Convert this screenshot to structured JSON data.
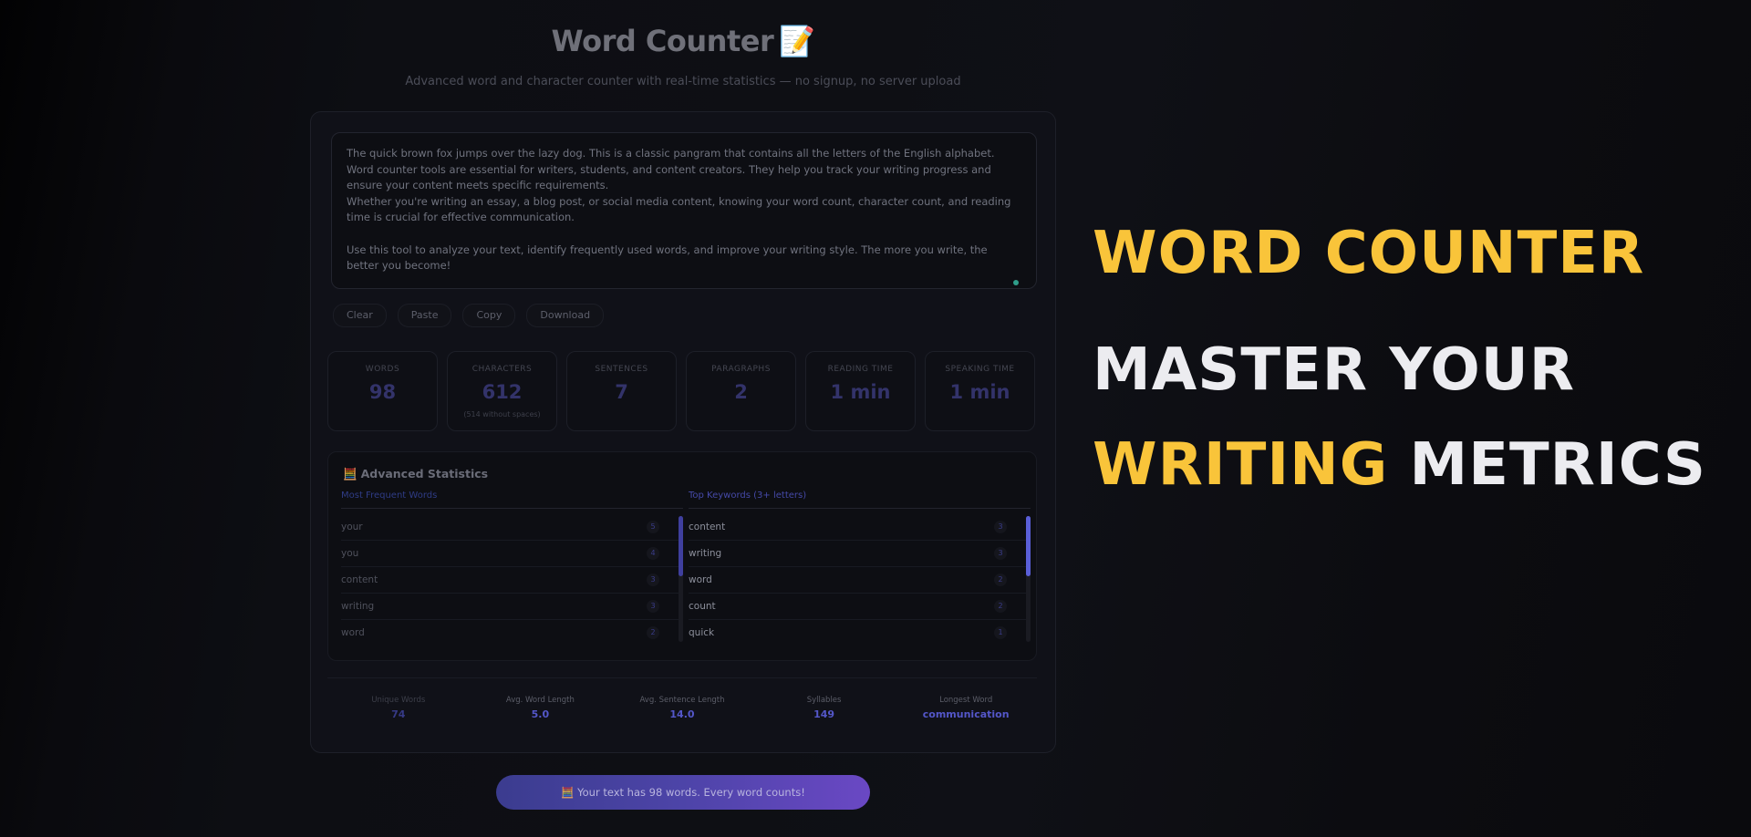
{
  "app": {
    "title": "Word Counter",
    "title_emoji": "📝",
    "subtitle": "Advanced word and character counter with real-time statistics — no signup, no server upload"
  },
  "editor": {
    "text": "The quick brown fox jumps over the lazy dog. This is a classic pangram that contains all the letters of the English alphabet.\nWord counter tools are essential for writers, students, and content creators. They help you track your writing progress and ensure your content meets specific requirements.\nWhether you're writing an essay, a blog post, or social media content, knowing your word count, character count, and reading time is crucial for effective communication.\n\nUse this tool to analyze your text, identify frequently used words, and improve your writing style. The more you write, the better you become!"
  },
  "actions": {
    "clear": "Clear",
    "paste": "Paste",
    "copy": "Copy",
    "download": "Download"
  },
  "stats": [
    {
      "label": "WORDS",
      "value": "98",
      "sub": ""
    },
    {
      "label": "CHARACTERS",
      "value": "612",
      "sub": "(514 without spaces)"
    },
    {
      "label": "SENTENCES",
      "value": "7",
      "sub": ""
    },
    {
      "label": "PARAGRAPHS",
      "value": "2",
      "sub": ""
    },
    {
      "label": "READING TIME",
      "value": "1 min",
      "sub": ""
    },
    {
      "label": "SPEAKING TIME",
      "value": "1 min",
      "sub": ""
    }
  ],
  "advanced": {
    "icon": "abacus-icon",
    "title": "Advanced Statistics",
    "frequent": {
      "heading": "Most Frequent Words",
      "items": [
        {
          "word": "your",
          "count": "5"
        },
        {
          "word": "you",
          "count": "4"
        },
        {
          "word": "content",
          "count": "3"
        },
        {
          "word": "writing",
          "count": "3"
        },
        {
          "word": "word",
          "count": "2"
        }
      ]
    },
    "keywords": {
      "heading": "Top Keywords (3+ letters)",
      "items": [
        {
          "word": "content",
          "count": "3"
        },
        {
          "word": "writing",
          "count": "3"
        },
        {
          "word": "word",
          "count": "2"
        },
        {
          "word": "count",
          "count": "2"
        },
        {
          "word": "quick",
          "count": "1"
        }
      ]
    }
  },
  "metrics": [
    {
      "label": "Unique Words",
      "value": "74"
    },
    {
      "label": "Avg. Word Length",
      "value": "5.0"
    },
    {
      "label": "Avg. Sentence Length",
      "value": "14.0"
    },
    {
      "label": "Syllables",
      "value": "149"
    },
    {
      "label": "Longest Word",
      "value": "communication"
    }
  ],
  "banner": {
    "icon": "abacus-icon",
    "text": "Your text has 98 words. Every word counts!"
  },
  "hero": {
    "line1": "WORD COUNTER",
    "line2": "MASTER YOUR",
    "line3_highlight": "WRITING",
    "line3_rest": " METRICS"
  },
  "colors": {
    "accent": "#f9c43a",
    "primary": "#5457c9",
    "background": "#0e0f14"
  }
}
